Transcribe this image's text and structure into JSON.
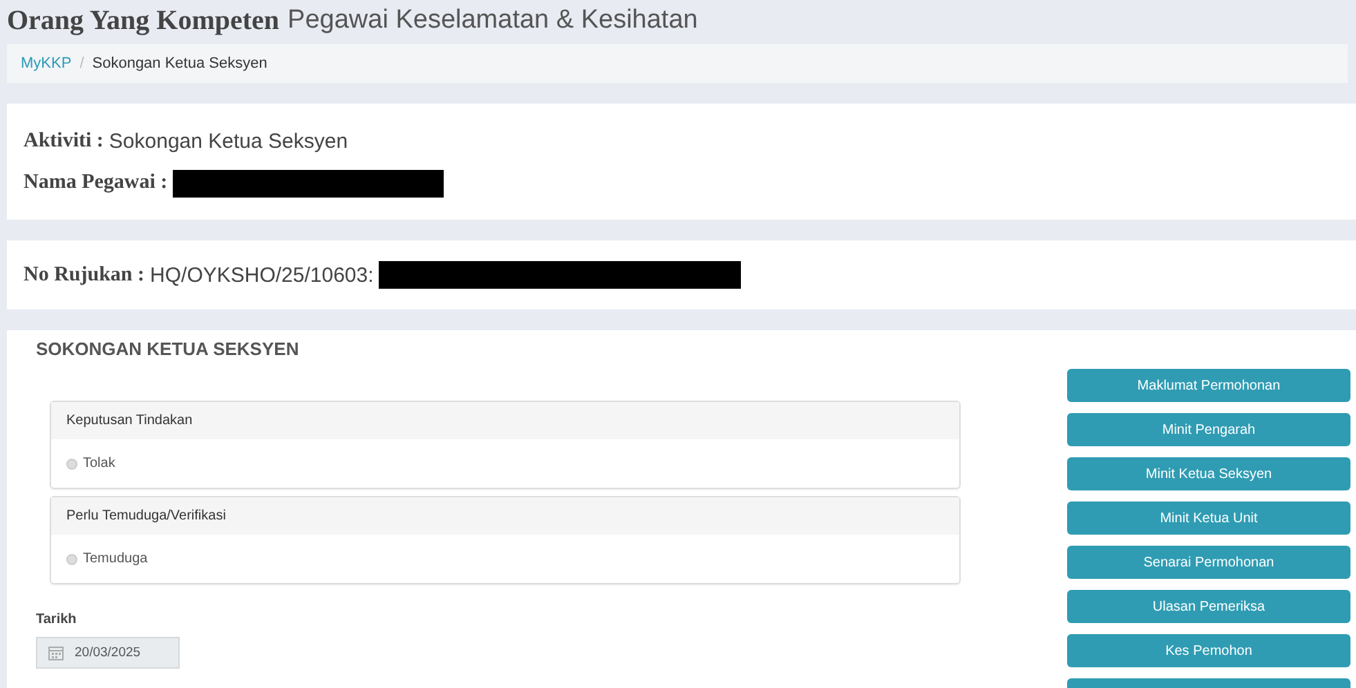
{
  "page_title": {
    "bold": "Orang Yang Kompeten",
    "rest": "Pegawai Keselamatan & Kesihatan"
  },
  "breadcrumb_separator": "/",
  "breadcrumb": [
    {
      "label": "MyKKP",
      "kind": "link"
    },
    {
      "label": "Sokongan Ketua Seksyen",
      "kind": "current"
    }
  ],
  "info_card": {
    "fields": [
      {
        "label": "Aktiviti :",
        "value": "Sokongan Ketua Seksyen"
      },
      {
        "label": "Nama Pegawai :",
        "redacted": true
      }
    ]
  },
  "reference_card": {
    "label": "No Rujukan :",
    "value": "HQ/OYKSHO/25/10603:",
    "redacted": true
  },
  "section": {
    "title": "SOKONGAN KETUA SEKSYEN",
    "groups": [
      {
        "heading": "Keputusan Tindakan",
        "options": [
          {
            "label": "Tolak",
            "selected": false
          }
        ]
      },
      {
        "heading": "Perlu Temuduga/Verifikasi",
        "options": [
          {
            "label": "Temuduga",
            "selected": false
          }
        ]
      }
    ],
    "date": {
      "label": "Tarikh",
      "value": "20/03/2025"
    },
    "buttons": [
      "Maklumat Permohonan",
      "Minit Pengarah",
      "Minit Ketua Seksyen",
      "Minit Ketua Unit",
      "Senarai Permohonan",
      "Ulasan Pemeriksa",
      "Kes Pemohon"
    ],
    "cut_off_button": true
  }
}
